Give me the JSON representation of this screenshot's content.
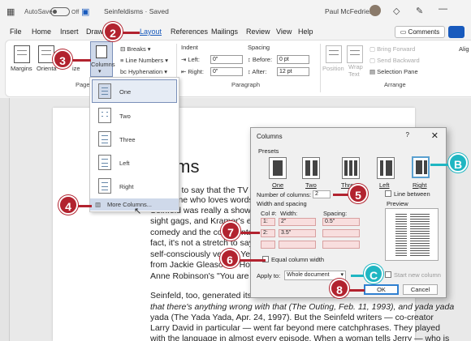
{
  "titlebar": {
    "autosave_label": "AutoSave",
    "autosave_state": "Off",
    "doc_title": "Seinfeldisms · Saved",
    "user_name": "Paul McFedries"
  },
  "menu": [
    "File",
    "Home",
    "Insert",
    "Draw",
    "Layout",
    "References",
    "Mailings",
    "Review",
    "View",
    "Help"
  ],
  "comments_label": "Comments",
  "ribbon": {
    "margins": "Margins",
    "orientation": "Orienta",
    "size": "ize",
    "columns": "Columns",
    "breaks": "Breaks",
    "line_numbers": "Line Numbers",
    "hyphenation": "Hyphenation",
    "page_setup_label": "Page S",
    "indent_label": "Indent",
    "left_label": "Left:",
    "left_value": "0\"",
    "right_label": "Right:",
    "right_value": "0\"",
    "spacing_label": "Spacing",
    "before_label": "Before:",
    "before_value": "0 pt",
    "after_label": "After:",
    "after_value": "12 pt",
    "paragraph_label": "Paragraph",
    "position": "Position",
    "wrap": "Wrap",
    "text": "Text",
    "bring_forward": "Bring Forward",
    "send_backward": "Send Backward",
    "selection_pane": "Selection Pane",
    "arrange_label": "Arrange",
    "align": "Alig"
  },
  "columns_menu": {
    "items": [
      "One",
      "Two",
      "Three",
      "Left",
      "Right"
    ],
    "more": "More Columns..."
  },
  "document": {
    "title": "disms",
    "lines": [
      "a cliché to say that the TV",
      "to anyone who loves words",
      "Seinfeld was really a show ab",
      "sight gags, and Kramer's entran",
      "comedy and the commentary i",
      "fact, it's not a stretch to say that",
      "self-consciously verbal. Yes, oth",
      "from Jackie Gleason's \"How sw",
      "Anne Robinson's \"You are the weakest li",
      "Seinfeld, too, generated its share of catch",
      "that there's anything wrong with that (The Outing, Feb. 11, 1993), and yada yada",
      "yada (The Yada Yada, Apr. 24, 1997). But the Seinfeld writers — co-creator",
      "Larry David in particular — went far beyond mere catchphrases. They played",
      "with the language in almost every episode. When a woman tells Jerry — who is"
    ]
  },
  "dialog": {
    "title": "Columns",
    "help": "?",
    "close": "✕",
    "presets_label": "Presets",
    "presets": [
      "One",
      "Two",
      "Three",
      "Left",
      "Right"
    ],
    "line_between": "Line between",
    "num_columns_label": "Number of columns:",
    "num_columns_value": "2",
    "width_spacing_label": "Width and spacing",
    "col_header": "Col #:",
    "width_header": "Width:",
    "spacing_header": "Spacing:",
    "rows": [
      {
        "col": "1:",
        "width": "2\"",
        "spacing": "0.5\""
      },
      {
        "col": "2:",
        "width": "3.5\"",
        "spacing": ""
      }
    ],
    "equal_width": "Equal column width",
    "preview_label": "Preview",
    "apply_to_label": "Apply to:",
    "apply_to_value": "Whole document",
    "start_new_column": "Start new column",
    "ok": "OK",
    "cancel": "Cancel"
  },
  "callouts": [
    "2",
    "3",
    "4",
    "5",
    "6",
    "7",
    "8",
    "B",
    "C"
  ],
  "colors": {
    "callout_red": "#b2232f",
    "callout_teal": "#1fb6c2",
    "accent": "#185abd"
  }
}
